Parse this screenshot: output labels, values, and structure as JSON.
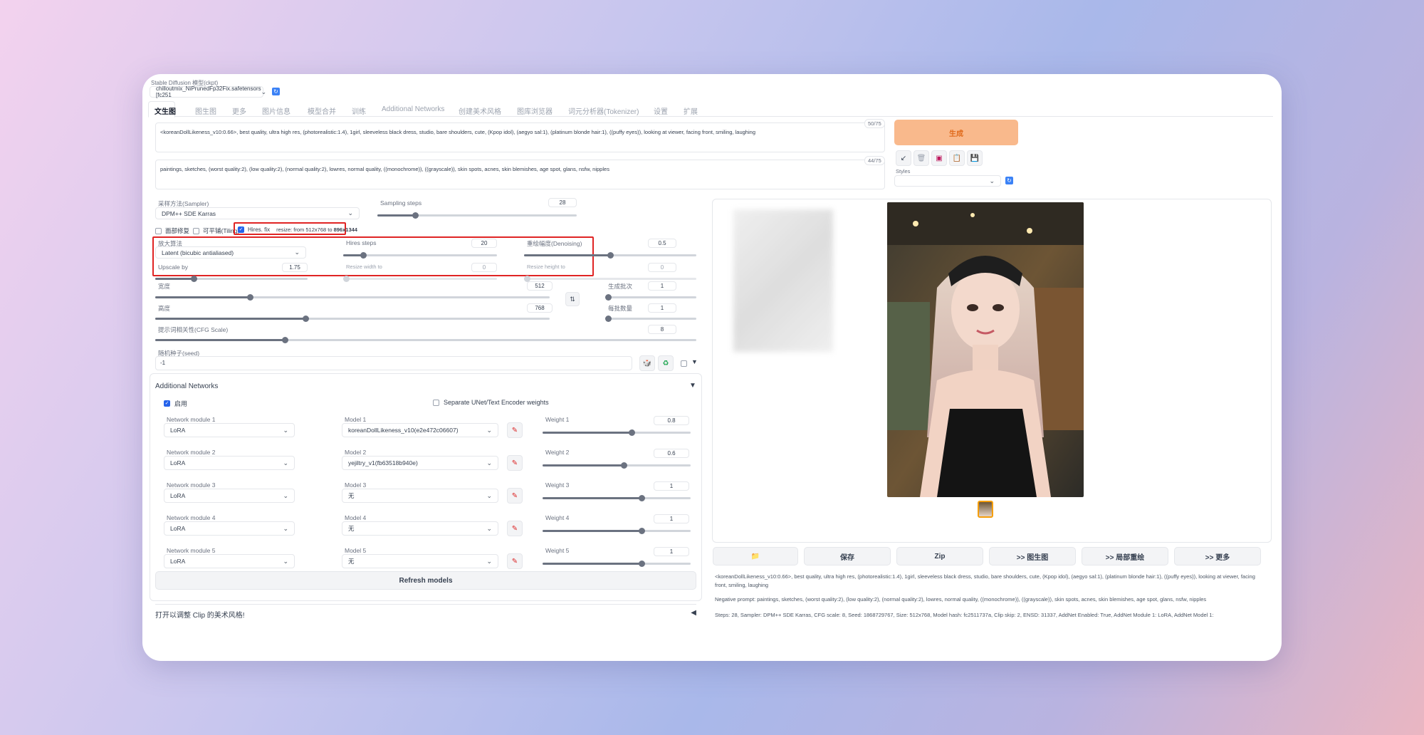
{
  "model": {
    "label": "Stable Diffusion 模型(ckpt)",
    "value": "chilloutmix_NiPrunedFp32Fix.safetensors [fc251"
  },
  "tabs": [
    "文生图",
    "图生图",
    "更多",
    "图片信息",
    "模型合并",
    "训练",
    "Additional Networks",
    "创建美术风格",
    "图库浏览器",
    "词元分析器(Tokenizer)",
    "设置",
    "扩展"
  ],
  "prompt": {
    "text": "<koreanDollLikeness_v10:0.66>, best quality, ultra high res, (photorealistic:1.4), 1girl, sleeveless black dress, studio, bare shoulders, cute, (Kpop idol), (aegyo sal:1), (platinum blonde hair:1), ((puffy eyes)), looking at viewer, facing front, smiling, laughing",
    "counter": "50/75"
  },
  "negative": {
    "text": "paintings, sketches, (worst quality:2), (low quality:2), (normal quality:2), lowres, normal quality, ((monochrome)), ((grayscale)), skin spots, acnes, skin blemishes, age spot, glans, nsfw, nipples",
    "counter": "44/75"
  },
  "generate_label": "生成",
  "styles_label": "Styles",
  "sampler": {
    "label": "采样方法(Sampler)",
    "value": "DPM++ SDE Karras"
  },
  "steps": {
    "label": "Sampling steps",
    "value": "28",
    "fraction": 0.19
  },
  "checks": {
    "restore": "面部修复",
    "tiling": "可平铺(Tiling)",
    "hires": "Hires. fix",
    "hires_info_prefix": "resize: from 512x768 to ",
    "hires_info_bold": "896x1344"
  },
  "hires": {
    "upscaler_label": "放大算法",
    "upscaler_value": "Latent (bicubic antialiased)",
    "steps_label": "Hires steps",
    "steps_value": "20",
    "steps_fraction": 0.13,
    "denoise_label": "重绘幅度(Denoising)",
    "denoise_value": "0.5",
    "denoise_fraction": 0.5,
    "upscale_label": "Upscale by",
    "upscale_value": "1.75",
    "upscale_fraction": 0.25,
    "rw_label": "Resize width to",
    "rw_value": "0",
    "rh_label": "Resize height to",
    "rh_value": "0"
  },
  "size": {
    "width_label": "宽度",
    "width_value": "512",
    "width_fraction": 0.24,
    "height_label": "高度",
    "height_value": "768",
    "height_fraction": 0.38,
    "batch_count_label": "生成批次",
    "batch_count_value": "1",
    "batch_size_label": "每批数量",
    "batch_size_value": "1"
  },
  "cfg": {
    "label": "提示词相关性(CFG Scale)",
    "value": "8",
    "fraction": 0.24
  },
  "seed": {
    "label": "随机种子(seed)",
    "value": "-1"
  },
  "addnet": {
    "title": "Additional Networks",
    "enable_label": "启用",
    "separate_label": "Separate UNet/Text Encoder weights",
    "rows": [
      {
        "module_label": "Network module 1",
        "module": "LoRA",
        "model_label": "Model 1",
        "model": "koreanDollLikeness_v10(e2e472c06607)",
        "weight_label": "Weight 1",
        "weight": "0.8",
        "fraction": 0.6
      },
      {
        "module_label": "Network module 2",
        "module": "LoRA",
        "model_label": "Model 2",
        "model": "yejiltry_v1(fb63518b940e)",
        "weight_label": "Weight 2",
        "weight": "0.6",
        "fraction": 0.55
      },
      {
        "module_label": "Network module 3",
        "module": "LoRA",
        "model_label": "Model 3",
        "model": "无",
        "weight_label": "Weight 3",
        "weight": "1",
        "fraction": 0.67
      },
      {
        "module_label": "Network module 4",
        "module": "LoRA",
        "model_label": "Model 4",
        "model": "无",
        "weight_label": "Weight 4",
        "weight": "1",
        "fraction": 0.67
      },
      {
        "module_label": "Network module 5",
        "module": "LoRA",
        "model_label": "Model 5",
        "model": "无",
        "weight_label": "Weight 5",
        "weight": "1",
        "fraction": 0.67
      }
    ],
    "refresh_label": "Refresh models"
  },
  "clip_section": "打开以调整 Clip 的美术风格!",
  "output": {
    "buttons": [
      "保存",
      "Zip",
      ">> 图生图",
      ">> 局部重绘",
      ">> 更多"
    ],
    "info_prompt": "<koreanDollLikeness_v10:0.66>, best quality, ultra high res, (photorealistic:1.4), 1girl, sleeveless black dress, studio, bare shoulders, cute, (Kpop idol), (aegyo sal:1), (platinum blonde hair:1), ((puffy eyes)), looking at viewer, facing front, smiling, laughing",
    "info_negative": "Negative prompt: paintings, sketches, (worst quality:2), (low quality:2), (normal quality:2), lowres, normal quality, ((monochrome)), ((grayscale)), skin spots, acnes, skin blemishes, age spot, glans, nsfw, nipples",
    "info_params": "Steps: 28, Sampler: DPM++ SDE Karras, CFG scale: 8, Seed: 1868729767, Size: 512x768, Model hash: fc2511737a, Clip skip: 2, ENSD: 31337, AddNet Enabled: True, AddNet Module 1: LoRA, AddNet Model 1:"
  },
  "colors": {
    "generate": "#f9b98c",
    "accent": "#e02424",
    "check": "#2563eb"
  }
}
